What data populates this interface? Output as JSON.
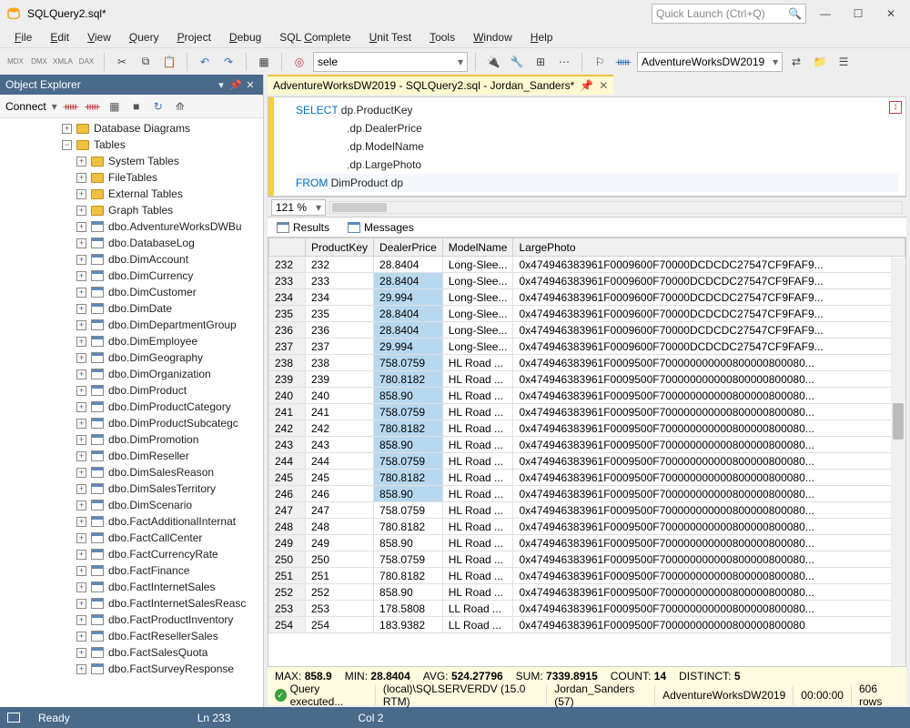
{
  "window": {
    "title": "SQLQuery2.sql*"
  },
  "quicklaunch": {
    "placeholder": "Quick Launch (Ctrl+Q)"
  },
  "menubar": {
    "file": "File",
    "edit": "Edit",
    "view": "View",
    "query": "Query",
    "project": "Project",
    "debug": "Debug",
    "sqlcomplete": "SQL Complete",
    "unittest": "Unit Test",
    "tools": "Tools",
    "window": "Window",
    "help": "Help"
  },
  "toolbar": {
    "sele": "sele",
    "db": "AdventureWorksDW2019"
  },
  "objectExplorer": {
    "title": "Object Explorer",
    "connect": "Connect",
    "folders": {
      "db_diagrams": "Database Diagrams",
      "tables": "Tables",
      "system_tables": "System Tables",
      "filetables": "FileTables",
      "external_tables": "External Tables",
      "graph_tables": "Graph Tables"
    },
    "tables": [
      "dbo.AdventureWorksDWBu",
      "dbo.DatabaseLog",
      "dbo.DimAccount",
      "dbo.DimCurrency",
      "dbo.DimCustomer",
      "dbo.DimDate",
      "dbo.DimDepartmentGroup",
      "dbo.DimEmployee",
      "dbo.DimGeography",
      "dbo.DimOrganization",
      "dbo.DimProduct",
      "dbo.DimProductCategory",
      "dbo.DimProductSubcategc",
      "dbo.DimPromotion",
      "dbo.DimReseller",
      "dbo.DimSalesReason",
      "dbo.DimSalesTerritory",
      "dbo.DimScenario",
      "dbo.FactAdditionalInternat",
      "dbo.FactCallCenter",
      "dbo.FactCurrencyRate",
      "dbo.FactFinance",
      "dbo.FactInternetSales",
      "dbo.FactInternetSalesReasc",
      "dbo.FactProductInventory",
      "dbo.FactResellerSales",
      "dbo.FactSalesQuota",
      "dbo.FactSurveyResponse"
    ]
  },
  "tab": {
    "label": "AdventureWorksDW2019 - SQLQuery2.sql - Jordan_Sanders*"
  },
  "code": {
    "l1a": "SELECT",
    "l1b": " dp",
    "l1c": ".",
    "l1d": "ProductKey",
    "l2a": ",",
    "l2b": "dp",
    "l2c": ".",
    "l2d": "DealerPrice",
    "l3a": ",",
    "l3b": "dp",
    "l3c": ".",
    "l3d": "ModelName",
    "l4a": ",",
    "l4b": "dp",
    "l4c": ".",
    "l4d": "LargePhoto",
    "l5a": "FROM",
    "l5b": " DimProduct dp"
  },
  "zoom": "121 %",
  "resultsTabs": {
    "results": "Results",
    "messages": "Messages"
  },
  "columns": {
    "c0": "",
    "c1": "ProductKey",
    "c2": "DealerPrice",
    "c3": "ModelName",
    "c4": "LargePhoto"
  },
  "rows": [
    {
      "n": "232",
      "pk": "232",
      "dp": "28.8404",
      "mn": "Long-Slee...",
      "lp": "0x474946383961F0009600F70000DCDCDC27547CF9FAF9...",
      "sel": false
    },
    {
      "n": "233",
      "pk": "233",
      "dp": "28.8404",
      "mn": "Long-Slee...",
      "lp": "0x474946383961F0009600F70000DCDCDC27547CF9FAF9...",
      "sel": true
    },
    {
      "n": "234",
      "pk": "234",
      "dp": "29.994",
      "mn": "Long-Slee...",
      "lp": "0x474946383961F0009600F70000DCDCDC27547CF9FAF9...",
      "sel": true
    },
    {
      "n": "235",
      "pk": "235",
      "dp": "28.8404",
      "mn": "Long-Slee...",
      "lp": "0x474946383961F0009600F70000DCDCDC27547CF9FAF9...",
      "sel": true
    },
    {
      "n": "236",
      "pk": "236",
      "dp": "28.8404",
      "mn": "Long-Slee...",
      "lp": "0x474946383961F0009600F70000DCDCDC27547CF9FAF9...",
      "sel": true
    },
    {
      "n": "237",
      "pk": "237",
      "dp": "29.994",
      "mn": "Long-Slee...",
      "lp": "0x474946383961F0009600F70000DCDCDC27547CF9FAF9...",
      "sel": true
    },
    {
      "n": "238",
      "pk": "238",
      "dp": "758.0759",
      "mn": "HL Road ...",
      "lp": "0x474946383961F0009500F700000000000800000800080...",
      "sel": true
    },
    {
      "n": "239",
      "pk": "239",
      "dp": "780.8182",
      "mn": "HL Road ...",
      "lp": "0x474946383961F0009500F700000000000800000800080...",
      "sel": true
    },
    {
      "n": "240",
      "pk": "240",
      "dp": "858.90",
      "mn": "HL Road ...",
      "lp": "0x474946383961F0009500F700000000000800000800080...",
      "sel": true
    },
    {
      "n": "241",
      "pk": "241",
      "dp": "758.0759",
      "mn": "HL Road ...",
      "lp": "0x474946383961F0009500F700000000000800000800080...",
      "sel": true
    },
    {
      "n": "242",
      "pk": "242",
      "dp": "780.8182",
      "mn": "HL Road ...",
      "lp": "0x474946383961F0009500F700000000000800000800080...",
      "sel": true
    },
    {
      "n": "243",
      "pk": "243",
      "dp": "858.90",
      "mn": "HL Road ...",
      "lp": "0x474946383961F0009500F700000000000800000800080...",
      "sel": true
    },
    {
      "n": "244",
      "pk": "244",
      "dp": "758.0759",
      "mn": "HL Road ...",
      "lp": "0x474946383961F0009500F700000000000800000800080...",
      "sel": true
    },
    {
      "n": "245",
      "pk": "245",
      "dp": "780.8182",
      "mn": "HL Road ...",
      "lp": "0x474946383961F0009500F700000000000800000800080...",
      "sel": true
    },
    {
      "n": "246",
      "pk": "246",
      "dp": "858.90",
      "mn": "HL Road ...",
      "lp": "0x474946383961F0009500F700000000000800000800080...",
      "sel": true
    },
    {
      "n": "247",
      "pk": "247",
      "dp": "758.0759",
      "mn": "HL Road ...",
      "lp": "0x474946383961F0009500F700000000000800000800080...",
      "sel": false
    },
    {
      "n": "248",
      "pk": "248",
      "dp": "780.8182",
      "mn": "HL Road ...",
      "lp": "0x474946383961F0009500F700000000000800000800080...",
      "sel": false
    },
    {
      "n": "249",
      "pk": "249",
      "dp": "858.90",
      "mn": "HL Road ...",
      "lp": "0x474946383961F0009500F700000000000800000800080...",
      "sel": false
    },
    {
      "n": "250",
      "pk": "250",
      "dp": "758.0759",
      "mn": "HL Road ...",
      "lp": "0x474946383961F0009500F700000000000800000800080...",
      "sel": false
    },
    {
      "n": "251",
      "pk": "251",
      "dp": "780.8182",
      "mn": "HL Road ...",
      "lp": "0x474946383961F0009500F700000000000800000800080...",
      "sel": false
    },
    {
      "n": "252",
      "pk": "252",
      "dp": "858.90",
      "mn": "HL Road ...",
      "lp": "0x474946383961F0009500F700000000000800000800080...",
      "sel": false
    },
    {
      "n": "253",
      "pk": "253",
      "dp": "178.5808",
      "mn": "LL Road ...",
      "lp": "0x474946383961F0009500F700000000000800000800080...",
      "sel": false
    },
    {
      "n": "254",
      "pk": "254",
      "dp": "183.9382",
      "mn": "LL Road ...",
      "lp": "0x474946383961F0009500F700000000000800000800080",
      "sel": false
    }
  ],
  "agg": {
    "max_l": "MAX:",
    "max_v": "858.9",
    "min_l": "MIN:",
    "min_v": "28.8404",
    "avg_l": "AVG:",
    "avg_v": "524.27796",
    "sum_l": "SUM:",
    "sum_v": "7339.8915",
    "count_l": "COUNT:",
    "count_v": "14",
    "distinct_l": "DISTINCT:",
    "distinct_v": "5"
  },
  "querystatus": {
    "exec": "Query  executed...",
    "server": "(local)\\SQLSERVERDV (15.0 RTM)",
    "user": "Jordan_Sanders (57)",
    "db": "AdventureWorksDW2019",
    "time": "00:00:00",
    "rows": "606 rows"
  },
  "statusbar": {
    "ready": "Ready",
    "ln": "Ln 233",
    "col": "Col 2"
  }
}
